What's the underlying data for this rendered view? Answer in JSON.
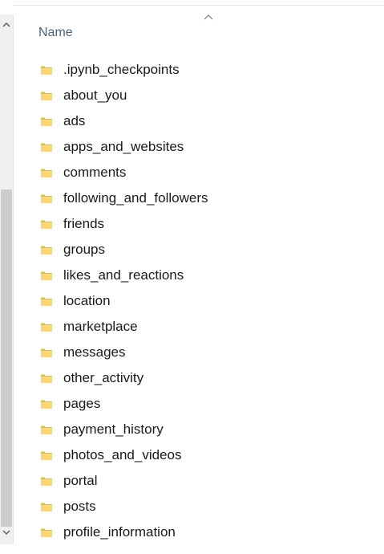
{
  "header": {
    "name_column_label": "Name",
    "sort_icon": "chevron-up-icon"
  },
  "scrollbar": {
    "up_icon": "chevron-up-icon",
    "down_icon": "chevron-down-icon"
  },
  "colors": {
    "folder_yellow": "#f8d775",
    "folder_shade": "#e4b94e",
    "header_text": "#4c607a",
    "thumb": "#cdcdcd"
  },
  "files": [
    {
      "name": ".ipynb_checkpoints",
      "icon": "folder-icon"
    },
    {
      "name": "about_you",
      "icon": "folder-icon"
    },
    {
      "name": "ads",
      "icon": "folder-icon"
    },
    {
      "name": "apps_and_websites",
      "icon": "folder-icon"
    },
    {
      "name": "comments",
      "icon": "folder-icon"
    },
    {
      "name": "following_and_followers",
      "icon": "folder-icon"
    },
    {
      "name": "friends",
      "icon": "folder-icon"
    },
    {
      "name": "groups",
      "icon": "folder-icon"
    },
    {
      "name": "likes_and_reactions",
      "icon": "folder-icon"
    },
    {
      "name": "location",
      "icon": "folder-icon"
    },
    {
      "name": "marketplace",
      "icon": "folder-icon"
    },
    {
      "name": "messages",
      "icon": "folder-icon"
    },
    {
      "name": "other_activity",
      "icon": "folder-icon"
    },
    {
      "name": "pages",
      "icon": "folder-icon"
    },
    {
      "name": "payment_history",
      "icon": "folder-icon"
    },
    {
      "name": "photos_and_videos",
      "icon": "folder-icon"
    },
    {
      "name": "portal",
      "icon": "folder-icon"
    },
    {
      "name": "posts",
      "icon": "folder-icon"
    },
    {
      "name": "profile_information",
      "icon": "folder-icon"
    }
  ]
}
